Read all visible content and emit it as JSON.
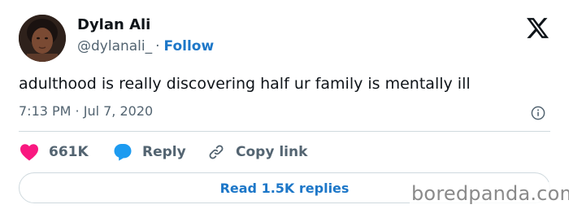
{
  "author": {
    "display_name": "Dylan Ali",
    "handle": "@dylanali_",
    "separator": "·",
    "follow_label": "Follow"
  },
  "tweet": {
    "text": "adulthood is really discovering half ur family is mentally ill",
    "timestamp": "7:13 PM · Jul 7, 2020"
  },
  "actions": {
    "like_count": "661K",
    "reply_label": "Reply",
    "copy_link_label": "Copy link"
  },
  "replies_button": {
    "label": "Read 1.5K replies"
  },
  "watermark": {
    "text": "boredpanda.com"
  },
  "icons": {
    "x_logo": "x-logo-icon",
    "info": "info-icon",
    "like": "heart-icon",
    "reply": "speech-bubble-icon",
    "copy_link": "link-icon"
  },
  "colors": {
    "link_blue": "#1d77c8",
    "like_pink": "#f91880",
    "reply_blue": "#1d9bf0",
    "secondary_text": "#536471",
    "divider": "#cfd9de"
  }
}
